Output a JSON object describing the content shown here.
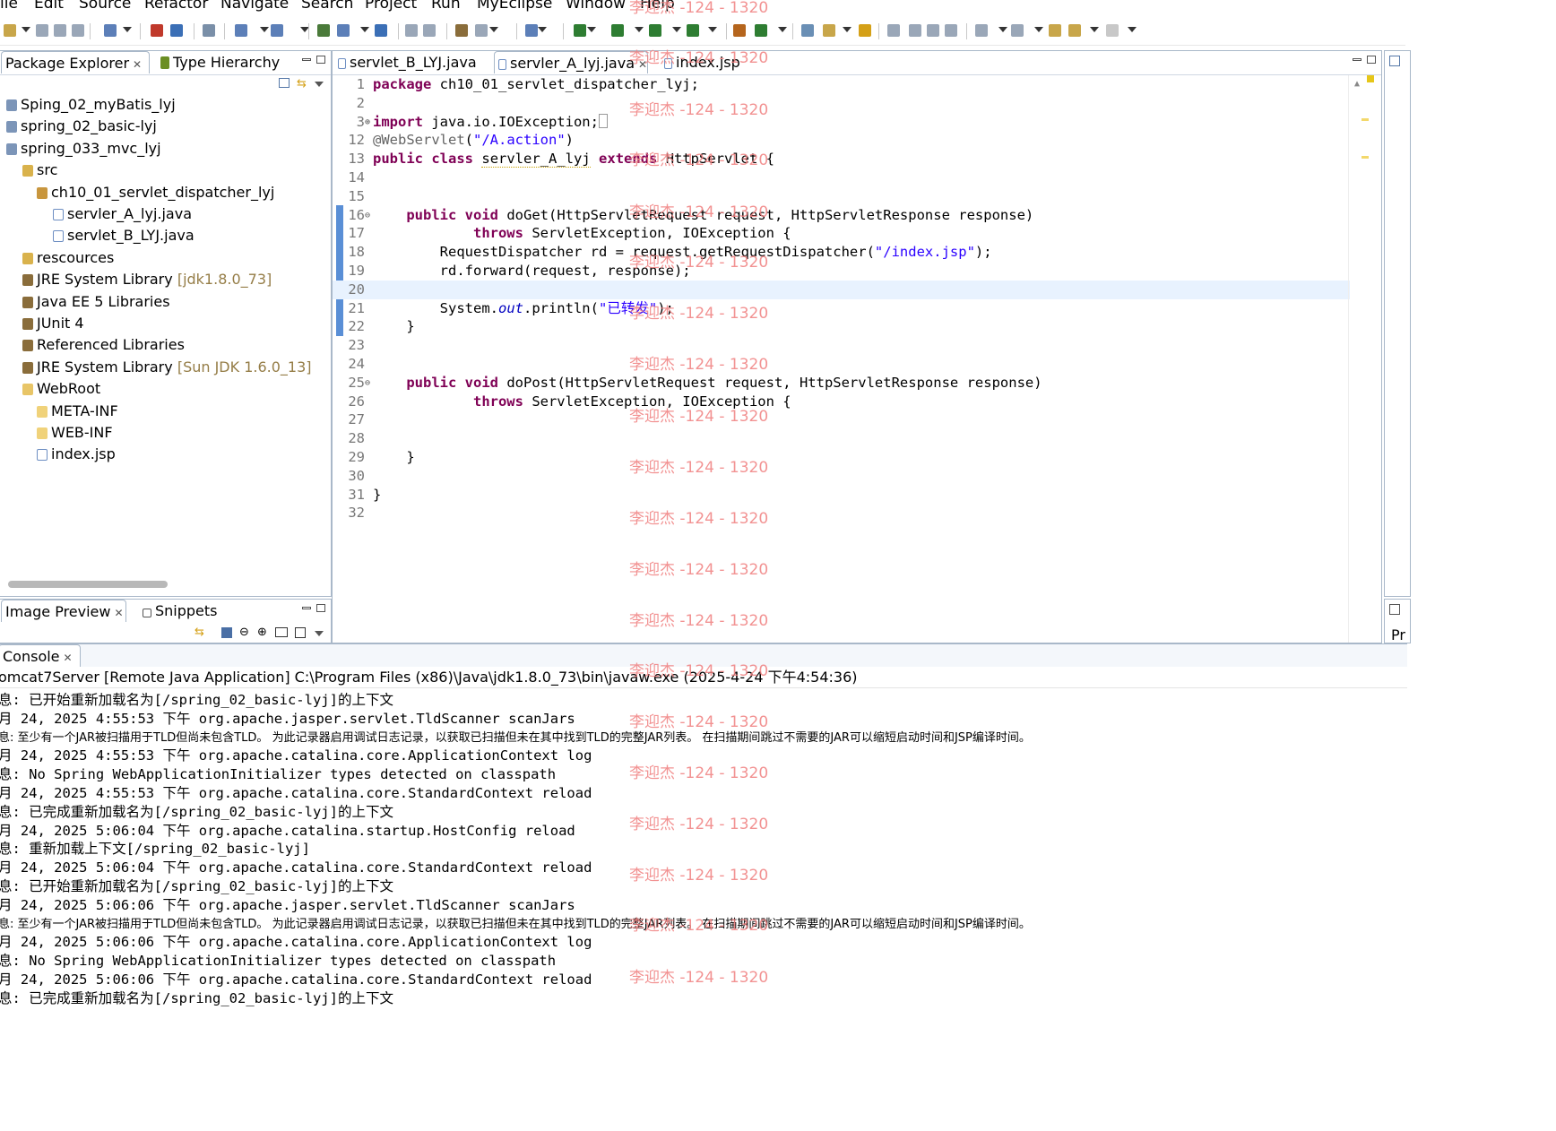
{
  "menu": [
    "ile",
    "Edit",
    "Source",
    "Refactor",
    "Navigate",
    "Search",
    "Project",
    "Run",
    "MyEclipse",
    "Window",
    "Help"
  ],
  "explorer": {
    "tabs": [
      {
        "label": "Package Explorer",
        "icon": "package-explorer-icon"
      },
      {
        "label": "Type Hierarchy",
        "icon": "type-hierarchy-icon"
      }
    ],
    "items": [
      {
        "label": "Sping_02_myBatis_lyj",
        "icon": "project-icon",
        "suffix": ""
      },
      {
        "label": "spring_02_basic-lyj",
        "icon": "project-icon",
        "suffix": ""
      },
      {
        "label": "spring_033_mvc_lyj",
        "icon": "project-icon",
        "suffix": ""
      },
      {
        "label": "src",
        "icon": "source-folder-icon",
        "suffix": ""
      },
      {
        "label": "ch10_01_servlet_dispatcher_lyj",
        "icon": "package-icon",
        "suffix": ""
      },
      {
        "label": "servler_A_lyj.java",
        "icon": "java-file-icon",
        "suffix": ""
      },
      {
        "label": "servlet_B_LYJ.java",
        "icon": "java-file-icon",
        "suffix": ""
      },
      {
        "label": "rescources",
        "icon": "source-folder-icon",
        "suffix": ""
      },
      {
        "label": "JRE System Library",
        "icon": "library-icon",
        "suffix": "[jdk1.8.0_73]"
      },
      {
        "label": "Java EE 5 Libraries",
        "icon": "library-icon",
        "suffix": ""
      },
      {
        "label": "JUnit 4",
        "icon": "library-icon",
        "suffix": ""
      },
      {
        "label": "Referenced Libraries",
        "icon": "library-icon",
        "suffix": ""
      },
      {
        "label": "JRE System Library",
        "icon": "library-icon",
        "suffix": "[Sun JDK 1.6.0_13]"
      },
      {
        "label": "WebRoot",
        "icon": "folder-open-icon",
        "suffix": ""
      },
      {
        "label": "META-INF",
        "icon": "folder-icon",
        "suffix": ""
      },
      {
        "label": "WEB-INF",
        "icon": "folder-icon",
        "suffix": ""
      },
      {
        "label": "index.jsp",
        "icon": "jsp-file-icon",
        "suffix": ""
      }
    ]
  },
  "preview": {
    "tabs": [
      {
        "label": "Image Preview",
        "icon": "image-preview-icon"
      },
      {
        "label": "Snippets",
        "icon": "snippets-icon"
      }
    ]
  },
  "editor": {
    "tabs": [
      {
        "label": "servlet_B_LYJ.java",
        "icon": "java-file-icon"
      },
      {
        "label": "servler_A_lyj.java",
        "icon": "java-file-icon"
      },
      {
        "label": "index.jsp",
        "icon": "jsp-file-icon"
      }
    ],
    "lines": [
      {
        "n": "1",
        "html": "<span class=\"kw\">package</span> ch10_01_servlet_dispatcher_lyj;"
      },
      {
        "n": "2",
        "html": ""
      },
      {
        "n": "3",
        "fold": "⊕",
        "html": "<span class=\"kw\">import</span> java.io.IOException;<span style=\"border:1px solid #999;display:inline-block;width:8px;height:14px;vertical-align:-2px\"></span>"
      },
      {
        "n": "12",
        "html": "<span class=\"ann\">@WebServlet</span>(<span class=\"str\">\"/A.action\"</span>)"
      },
      {
        "n": "13",
        "html": "<span class=\"kw\">public</span> <span class=\"kw\">class</span> <span class=\"warn-ul\">servler_A_lyj</span> <span class=\"kw\">extends</span> HttpServlet {"
      },
      {
        "n": "14",
        "html": ""
      },
      {
        "n": "15",
        "html": ""
      },
      {
        "n": "16",
        "fold": "⊖",
        "html": "    <span class=\"kw\">public</span> <span class=\"kw\">void</span> doGet(HttpServletRequest request, HttpServletResponse response)"
      },
      {
        "n": "17",
        "html": "            <span class=\"kw\">throws</span> ServletException, IOException {"
      },
      {
        "n": "18",
        "html": "        RequestDispatcher rd = request.getRequestDispatcher(<span class=\"str\">\"/index.jsp\"</span>);"
      },
      {
        "n": "19",
        "html": "        rd.forward(request, response);"
      },
      {
        "n": "20",
        "html": ""
      },
      {
        "n": "21",
        "html": "        System.<span class=\"fld\">out</span>.println(<span class=\"str\">\"<span style=\\\"font-family:'DejaVu Sans',sans-serif;font-size:12px\\\">已转发</span>\"</span>);"
      },
      {
        "n": "22",
        "html": "    }"
      },
      {
        "n": "23",
        "html": ""
      },
      {
        "n": "24",
        "html": ""
      },
      {
        "n": "25",
        "fold": "⊖",
        "html": "    <span class=\"kw\">public</span> <span class=\"kw\">void</span> doPost(HttpServletRequest request, HttpServletResponse response)"
      },
      {
        "n": "26",
        "html": "            <span class=\"kw\">throws</span> ServletException, IOException {"
      },
      {
        "n": "27",
        "html": ""
      },
      {
        "n": "28",
        "html": ""
      },
      {
        "n": "29",
        "html": "    }"
      },
      {
        "n": "30",
        "html": ""
      },
      {
        "n": "31",
        "html": "}"
      },
      {
        "n": "32",
        "html": ""
      }
    ]
  },
  "console": {
    "tab": "Console",
    "header": "omcat7Server [Remote Java Application] C:\\Program Files (x86)\\Java\\jdk1.8.0_73\\bin\\javaw.exe (2025-4-24 下午4:54:36)",
    "lines": [
      "息: 已开始重新加载名为[/spring_02_basic-lyj]的上下文",
      "月 24, 2025 4:55:53 下午 org.apache.jasper.servlet.TldScanner scanJars",
      "息: 至少有一个JAR被扫描用于TLD但尚未包含TLD。 为此记录器启用调试日志记录，以获取已扫描但未在其中找到TLD的完整JAR列表。 在扫描期间跳过不需要的JAR可以缩短启动时间和JSP编译时间。",
      "月 24, 2025 4:55:53 下午 org.apache.catalina.core.ApplicationContext log",
      "息: No Spring WebApplicationInitializer types detected on classpath",
      "月 24, 2025 4:55:53 下午 org.apache.catalina.core.StandardContext reload",
      "息: 已完成重新加载名为[/spring_02_basic-lyj]的上下文",
      "月 24, 2025 5:06:04 下午 org.apache.catalina.startup.HostConfig reload",
      "息: 重新加载上下文[/spring_02_basic-lyj]",
      "月 24, 2025 5:06:04 下午 org.apache.catalina.core.StandardContext reload",
      "息: 已开始重新加载名为[/spring_02_basic-lyj]的上下文",
      "月 24, 2025 5:06:06 下午 org.apache.jasper.servlet.TldScanner scanJars",
      "息: 至少有一个JAR被扫描用于TLD但尚未包含TLD。 为此记录器启用调试日志记录，以获取已扫描但未在其中找到TLD的完整JAR列表。 在扫描期间跳过不需要的JAR可以缩短启动时间和JSP编译时间。",
      "月 24, 2025 5:06:06 下午 org.apache.catalina.core.ApplicationContext log",
      "息: No Spring WebApplicationInitializer types detected on classpath",
      "月 24, 2025 5:06:06 下午 org.apache.catalina.core.StandardContext reload",
      "息: 已完成重新加载名为[/spring_02_basic-lyj]的上下文"
    ]
  },
  "right_pane": {
    "label": "Pr"
  },
  "watermark": "李迎杰 -124 - 1320",
  "colors": {
    "keyword": "#7f0055",
    "string": "#2a00ff",
    "current_line": "#e8f2fe",
    "watermark": "#f08080"
  }
}
